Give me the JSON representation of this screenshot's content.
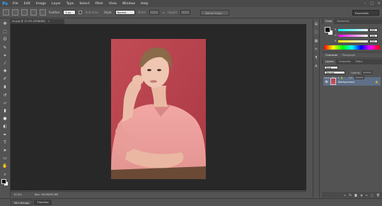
{
  "app": {
    "logo": "Ps"
  },
  "menu": [
    "File",
    "Edit",
    "Image",
    "Layer",
    "Type",
    "Select",
    "Filter",
    "View",
    "Window",
    "Help"
  ],
  "window_controls": [
    "–",
    "□",
    "×"
  ],
  "options": {
    "feather_label": "Feather:",
    "feather_value": "0 px",
    "antialias_label": "Anti-alias",
    "style_label": "Style:",
    "style_value": "Normal",
    "width_label": "Width:",
    "height_label": "Height:",
    "refine_edge": "Refine Edge...",
    "workspace": "Essentials"
  },
  "document": {
    "tab_title": "ev.jpg @ 12.5% (RGB/8#)",
    "close": "×",
    "zoom": "12.5%",
    "doc_size": "Doc: 30.9M/30.9M"
  },
  "bottom_tabs": [
    "Mini Bridge",
    "Timeline"
  ],
  "color_panel": {
    "tabs": [
      "Color",
      "Swatches"
    ],
    "channels": [
      {
        "label": "R",
        "value": "255",
        "color": "#ff0000"
      },
      {
        "label": "G",
        "value": "255",
        "color": "#00ff00"
      },
      {
        "label": "B",
        "value": "255",
        "color": "#0000ff"
      }
    ]
  },
  "character_tabs": [
    "Character",
    "Paragraph"
  ],
  "layers_panel": {
    "tabs": [
      "Layers",
      "Channels",
      "Paths"
    ],
    "kind": "Kind",
    "blend_mode": "Normal",
    "opacity_label": "Opacity:",
    "lock_label": "Lock:",
    "fill_label": "Fill:",
    "layers": [
      {
        "name": "Background",
        "visible": "👁",
        "lock": "🔒"
      }
    ]
  },
  "tools": [
    "move",
    "marquee",
    "lasso",
    "quick-select",
    "crop",
    "eyedropper",
    "spot-heal",
    "brush",
    "clone-stamp",
    "history-brush",
    "eraser",
    "gradient",
    "blur",
    "dodge",
    "pen",
    "type",
    "path-select",
    "shape",
    "hand",
    "zoom"
  ]
}
